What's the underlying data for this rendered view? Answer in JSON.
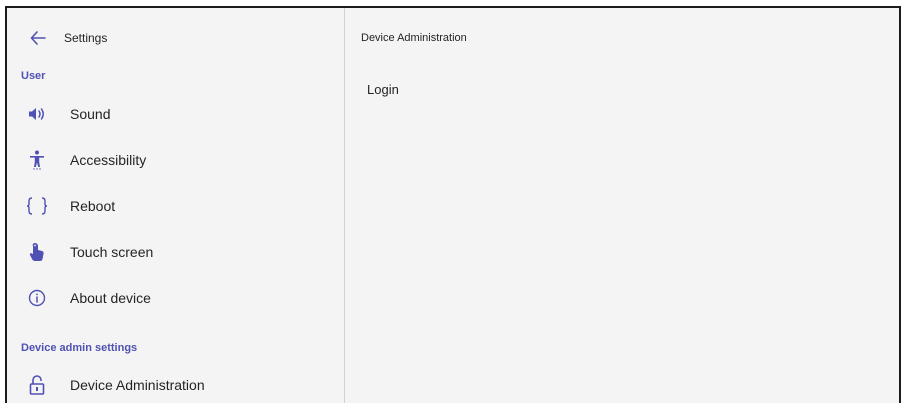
{
  "sidebar": {
    "header_title": "Settings",
    "sections": [
      {
        "label": "User"
      },
      {
        "label": "Device admin settings"
      }
    ],
    "items": [
      {
        "label": "Sound",
        "icon": "speaker-icon"
      },
      {
        "label": "Accessibility",
        "icon": "accessibility-icon"
      },
      {
        "label": "Reboot",
        "icon": "braces-icon"
      },
      {
        "label": "Touch screen",
        "icon": "touch-icon"
      },
      {
        "label": "About device",
        "icon": "info-icon"
      },
      {
        "label": "Device Administration",
        "icon": "unlock-icon"
      }
    ]
  },
  "main": {
    "title": "Device Administration",
    "login_label": "Login"
  },
  "colors": {
    "accent": "#4f52b2",
    "background": "#f4f4f4",
    "text": "#252423"
  }
}
